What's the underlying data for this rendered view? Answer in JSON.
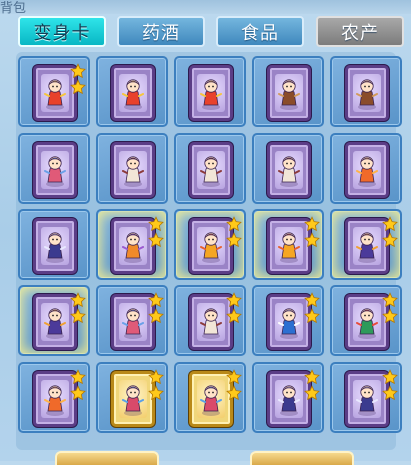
{
  "header": {
    "title_fragment": "背包"
  },
  "tabs": [
    {
      "label": "变身卡",
      "state": "active"
    },
    {
      "label": "药酒",
      "state": "normal"
    },
    {
      "label": "食品",
      "state": "normal"
    },
    {
      "label": "农产",
      "state": "dim"
    }
  ],
  "colors": {
    "card_purple": "#9a83c6",
    "card_gold": "#f0d67a",
    "star": "#ffc91a",
    "tab_active": "#18cdd8"
  },
  "grid": {
    "rows": [
      [
        {
          "card": "purple",
          "figure": "lion-dancer",
          "stars": 2,
          "glow": false
        },
        {
          "card": "purple",
          "figure": "lion-dancer",
          "stars": 0,
          "glow": false
        },
        {
          "card": "purple",
          "figure": "lion-dancer",
          "stars": 0,
          "glow": false
        },
        {
          "card": "purple",
          "figure": "monkey-warrior",
          "stars": 0,
          "glow": false
        },
        {
          "card": "purple",
          "figure": "monkey-warrior",
          "stars": 0,
          "glow": false
        }
      ],
      [
        {
          "card": "purple",
          "figure": "dancer-girl",
          "stars": 0,
          "glow": false
        },
        {
          "card": "purple",
          "figure": "winged-fairy",
          "stars": 0,
          "glow": false
        },
        {
          "card": "purple",
          "figure": "winged-fairy",
          "stars": 0,
          "glow": false
        },
        {
          "card": "purple",
          "figure": "winged-fairy",
          "stars": 0,
          "glow": false
        },
        {
          "card": "purple",
          "figure": "phoenix",
          "stars": 0,
          "glow": false
        }
      ],
      [
        {
          "card": "purple",
          "figure": "ninja",
          "stars": 0,
          "glow": false
        },
        {
          "card": "purple",
          "figure": "fox-spirit",
          "stars": 2,
          "glow": true
        },
        {
          "card": "purple",
          "figure": "fire-fairy",
          "stars": 2,
          "glow": true
        },
        {
          "card": "purple",
          "figure": "fire-fairy",
          "stars": 2,
          "glow": true
        },
        {
          "card": "purple",
          "figure": "ninja-mage",
          "stars": 2,
          "glow": true
        }
      ],
      [
        {
          "card": "purple",
          "figure": "ninja-mage",
          "stars": 2,
          "glow": true
        },
        {
          "card": "purple",
          "figure": "dancer-girl",
          "stars": 2,
          "glow": false
        },
        {
          "card": "purple",
          "figure": "winged-fairy",
          "stars": 2,
          "glow": false
        },
        {
          "card": "purple",
          "figure": "panda-knight",
          "stars": 2,
          "glow": false
        },
        {
          "card": "purple",
          "figure": "dragon",
          "stars": 2,
          "glow": false
        }
      ],
      [
        {
          "card": "purple",
          "figure": "phoenix",
          "stars": 2,
          "glow": false
        },
        {
          "card": "gold",
          "figure": "fairy-princess",
          "stars": 2,
          "glow": false
        },
        {
          "card": "gold",
          "figure": "fairy-princess",
          "stars": 2,
          "glow": false
        },
        {
          "card": "purple",
          "figure": "ninja",
          "stars": 2,
          "glow": false
        },
        {
          "card": "purple",
          "figure": "ninja",
          "stars": 2,
          "glow": false
        }
      ]
    ]
  }
}
